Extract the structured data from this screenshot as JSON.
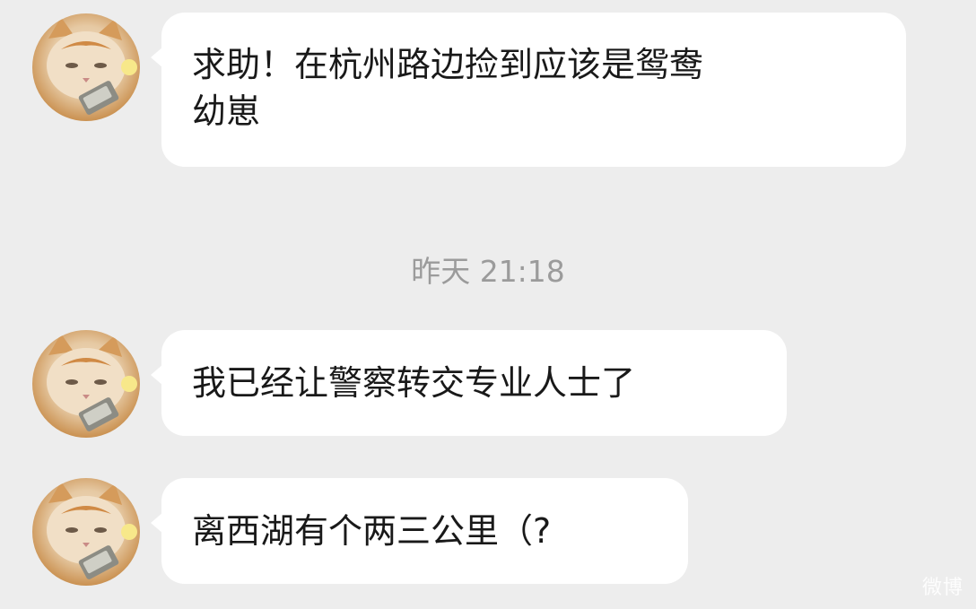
{
  "messages": [
    {
      "text": "求助！在杭州路边捡到应该是鸳鸯\n幼崽"
    },
    {
      "text": "我已经让警察转交专业人士了"
    },
    {
      "text": "离西湖有个两三公里（?"
    }
  ],
  "timestamp": "昨天 21:18",
  "watermark": "微博"
}
